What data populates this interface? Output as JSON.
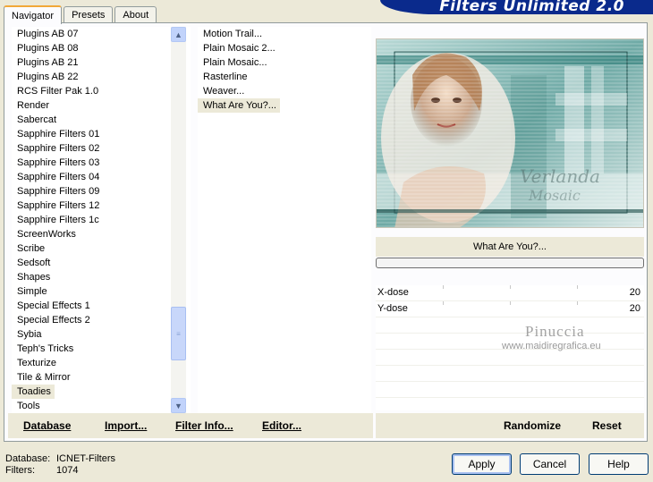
{
  "tabs": [
    "Navigator",
    "Presets",
    "About"
  ],
  "banner_title": "Filters Unlimited 2.0",
  "categories": [
    "Plugins AB 07",
    "Plugins AB 08",
    "Plugins AB 21",
    "Plugins AB 22",
    "RCS Filter Pak 1.0",
    "Render",
    "Sabercat",
    "Sapphire Filters 01",
    "Sapphire Filters 02",
    "Sapphire Filters 03",
    "Sapphire Filters 04",
    "Sapphire Filters 09",
    "Sapphire Filters 12",
    "Sapphire Filters 1c",
    "ScreenWorks",
    "Scribe",
    "Sedsoft",
    "Shapes",
    "Simple",
    "Special Effects 1",
    "Special Effects 2",
    "Sybia",
    "Teph's Tricks",
    "Texturize",
    "Tile & Mirror",
    "Toadies",
    "Tools"
  ],
  "selected_category": "Toadies",
  "filters": [
    "Motion Trail...",
    "Plain Mosaic 2...",
    "Plain Mosaic...",
    "Rasterline",
    "Weaver...",
    "What Are You?..."
  ],
  "selected_filter": "What Are You?...",
  "left_buttons": {
    "database": "Database",
    "import": "Import...",
    "filter_info": "Filter Info...",
    "editor": "Editor..."
  },
  "filter_name": "What Are You?...",
  "params": [
    {
      "label": "X-dose",
      "value": "20"
    },
    {
      "label": "Y-dose",
      "value": "20"
    }
  ],
  "watermark": {
    "name": "Pinuccia",
    "url": "www.maidiregrafica.eu"
  },
  "right_buttons": {
    "randomize": "Randomize",
    "reset": "Reset"
  },
  "status": {
    "database_label": "Database:",
    "database_value": "ICNET-Filters",
    "filters_label": "Filters:",
    "filters_value": "1074"
  },
  "dialog_buttons": {
    "apply": "Apply",
    "cancel": "Cancel",
    "help": "Help"
  }
}
